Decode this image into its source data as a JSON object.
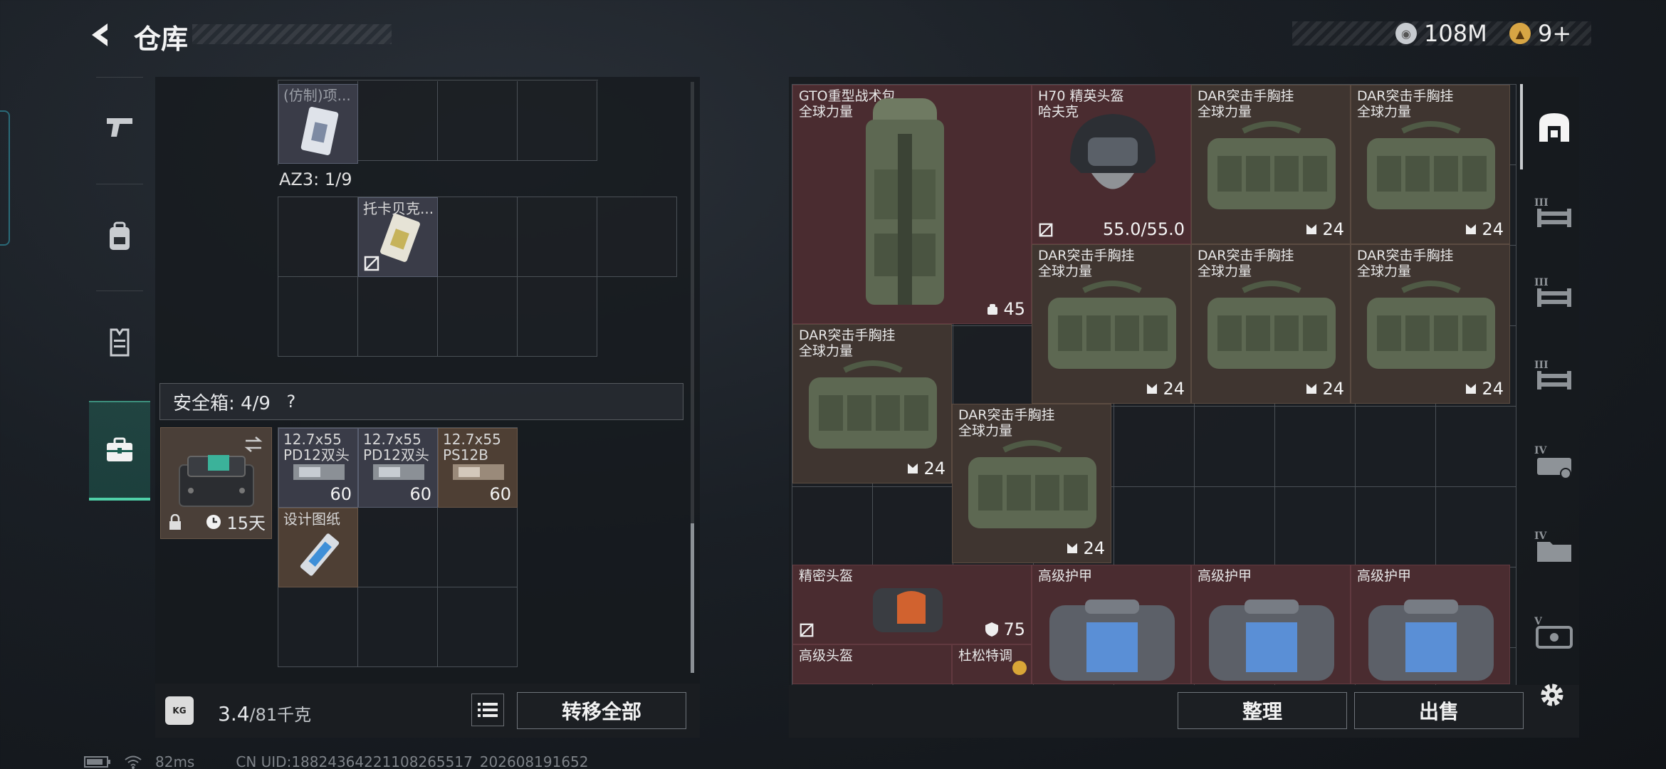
{
  "header": {
    "title": "仓库"
  },
  "currency": [
    {
      "icon": "silver-coin-icon",
      "value": "108M"
    },
    {
      "icon": "gold-coin-icon",
      "value": "9+"
    }
  ],
  "left_nav": [
    {
      "icon": "pistol-icon"
    },
    {
      "icon": "backpack-icon"
    },
    {
      "icon": "vest-icon"
    },
    {
      "icon": "briefcase-icon"
    }
  ],
  "left_panel": {
    "top_item": {
      "name": "(仿制)项..."
    },
    "az3_label": "AZ3: 1/9",
    "az3_item": {
      "name": "托卡贝克..."
    },
    "safebox_label": "安全箱: 4/9",
    "safebox_help": "?",
    "safebox_timer": "15天",
    "ammo": [
      {
        "name_line1": "12.7x55",
        "name_line2": "PD12双头",
        "count": "60"
      },
      {
        "name_line1": "12.7x55",
        "name_line2": "PD12双头",
        "count": "60"
      },
      {
        "name_line1": "12.7x55",
        "name_line2": "PS12B",
        "count": "60"
      }
    ],
    "blueprint": {
      "name": "设计图纸"
    },
    "weight_value": "3.4",
    "weight_total": "/81千克",
    "weight_icon_label": "KG",
    "transfer_all": "转移全部"
  },
  "right_panel": {
    "items": [
      {
        "name": "GTO重型战术包",
        "sub": "全球力量",
        "count": "45"
      },
      {
        "name": "H70 精英头盔",
        "sub": "哈夫克",
        "count": "55.0/55.0"
      },
      {
        "name": "DAR突击手胸挂",
        "sub": "全球力量",
        "count": "24"
      },
      {
        "name": "DAR突击手胸挂",
        "sub": "全球力量",
        "count": "24"
      },
      {
        "name": "DAR突击手胸挂",
        "sub": "全球力量",
        "count": "24"
      },
      {
        "name": "DAR突击手胸挂",
        "sub": "全球力量",
        "count": "24"
      },
      {
        "name": "DAR突击手胸挂",
        "sub": "全球力量",
        "count": "24"
      },
      {
        "name": "DAR突击手胸挂",
        "sub": "全球力量",
        "count": "24"
      },
      {
        "name": "DAR突击手胸挂",
        "sub": "全球力量",
        "count": "24"
      },
      {
        "name": "精密头盔",
        "sub": "",
        "count": "75"
      },
      {
        "name": "高级护甲",
        "sub": "",
        "count": ""
      },
      {
        "name": "高级护甲",
        "sub": "",
        "count": ""
      },
      {
        "name": "高级护甲",
        "sub": "",
        "count": ""
      },
      {
        "name": "高级头盔",
        "sub": "",
        "count": ""
      },
      {
        "name": "杜松特调",
        "sub": "",
        "count": ""
      }
    ],
    "sort_button": "整理",
    "sell_button": "出售"
  },
  "right_nav": [
    {
      "icon": "storage-icon",
      "tier": ""
    },
    {
      "icon": "shelf-icon",
      "tier": "III"
    },
    {
      "icon": "shelf-icon",
      "tier": "III"
    },
    {
      "icon": "shelf-icon",
      "tier": "III"
    },
    {
      "icon": "shelf-icon",
      "tier": "IV"
    },
    {
      "icon": "folder-icon",
      "tier": "IV"
    },
    {
      "icon": "case-icon",
      "tier": "V"
    }
  ],
  "status_bar": {
    "ping": "82ms",
    "uid": "CN UID:18824364221108265517_202608191652"
  },
  "colors": {
    "accent": "#4fd0a8",
    "item_red": "#4a2c30",
    "item_brown": "#3f3530"
  }
}
